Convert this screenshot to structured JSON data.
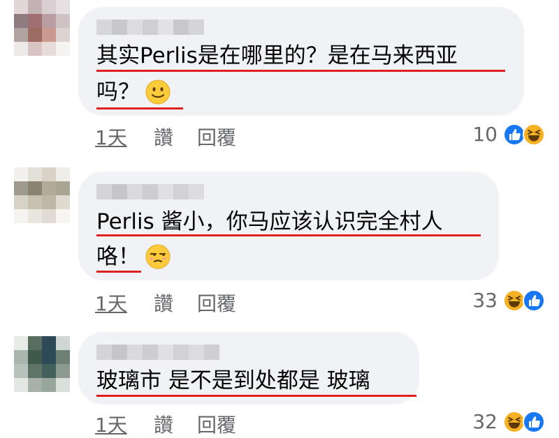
{
  "colors": {
    "bubble": "#f0f2f5",
    "underline": "#e02020",
    "meta_text": "#65676b",
    "like_blue": "#1877f2",
    "haha_yellow": "#f7b125"
  },
  "comments": [
    {
      "line1": "其实Perlis是在哪里的？是在马来西亚",
      "line2": "吗？",
      "emoji": "slightly-smiling-face-icon",
      "time": "1天",
      "like": "讚",
      "reply": "回覆",
      "reaction_count": "10",
      "reactions": [
        "like-reaction-icon",
        "haha-reaction-icon"
      ]
    },
    {
      "line1": "Perlis 酱小，你马应该认识完全村人",
      "line2": "咯！",
      "emoji": "unamused-face-icon",
      "time": "1天",
      "like": "讚",
      "reply": "回覆",
      "reaction_count": "33",
      "reactions": [
        "haha-reaction-icon",
        "like-reaction-icon"
      ]
    },
    {
      "line1": "玻璃市 是不是到处都是 玻璃",
      "time": "1天",
      "like": "讚",
      "reply": "回覆",
      "reaction_count": "32",
      "reactions": [
        "haha-reaction-icon",
        "like-reaction-icon"
      ]
    }
  ]
}
